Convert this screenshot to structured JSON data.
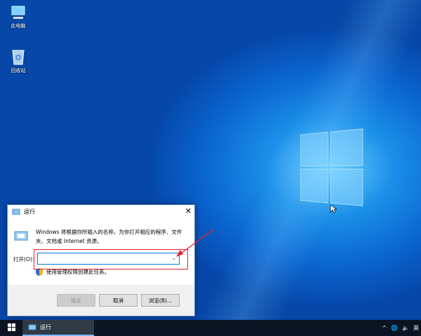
{
  "desktop": {
    "icons": [
      {
        "label": "此电脑",
        "icon": "computer-icon"
      },
      {
        "label": "回收站",
        "icon": "recycle-bin-icon"
      }
    ]
  },
  "dialog": {
    "title": "运行",
    "description": "Windows 将根据你所输入的名称，为你打开相应的程序、文件夹、文档或 Internet 资源。",
    "open_label": "打开(O):",
    "input_value": "",
    "admin_note": "使用管理权限创建此任务。",
    "ok": "确定",
    "cancel": "取消",
    "browse": "浏览(B)..."
  },
  "taskbar": {
    "app_label": "运行",
    "ime": "英"
  },
  "colors": {
    "highlight": "#e8202a",
    "accent": "#0078d7"
  }
}
